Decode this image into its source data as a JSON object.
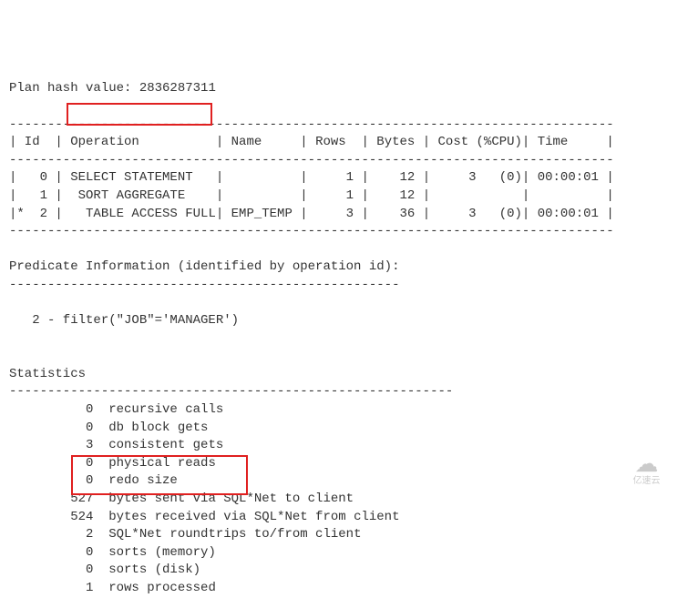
{
  "plan_hash_label": "Plan hash value: ",
  "plan_hash_value": "2836287311",
  "div_line": "-------------------------------------------------------------------------------",
  "header": {
    "id": "| Id  |",
    "operation": " Operation          |",
    "name": " Name     |",
    "rows": " Rows  |",
    "bytes": " Bytes |",
    "cost": " Cost (%CPU)|",
    "time": " Time     |"
  },
  "rows": [
    {
      "id": "|   0 |",
      "op": " SELECT STATEMENT   |",
      "name": "          |",
      "rows": "     1 |",
      "bytes": "    12 |",
      "cost": "     3   (0)|",
      "time": " 00:00:01 |"
    },
    {
      "id": "|   1 |",
      "op": "  SORT AGGREGATE    |",
      "name": "          |",
      "rows": "     1 |",
      "bytes": "    12 |",
      "cost": "            |",
      "time": "          |"
    },
    {
      "id": "|*  2 |",
      "op": "   TABLE ACCESS FULL|",
      "name": " EMP_TEMP |",
      "rows": "     3 |",
      "bytes": "    36 |",
      "cost": "     3   (0)|",
      "time": " 00:00:01 |"
    }
  ],
  "predicate_header": "Predicate Information (identified by operation id):",
  "predicate_line": "---------------------------------------------------",
  "predicate": "   2 - filter(\"JOB\"='MANAGER')",
  "stats_header": "Statistics",
  "stats_line": "----------------------------------------------------------",
  "stats": [
    {
      "val": "          0",
      "label": "  recursive calls"
    },
    {
      "val": "          0",
      "label": "  db block gets"
    },
    {
      "val": "          3",
      "label": "  consistent gets"
    },
    {
      "val": "          0",
      "label": "  physical reads"
    },
    {
      "val": "          0",
      "label": "  redo size"
    },
    {
      "val": "        527",
      "label": "  bytes sent via SQL*Net to client"
    },
    {
      "val": "        524",
      "label": "  bytes received via SQL*Net from client"
    },
    {
      "val": "          2",
      "label": "  SQL*Net roundtrips to/from client"
    },
    {
      "val": "          0",
      "label": "  sorts (memory)"
    },
    {
      "val": "          0",
      "label": "  sorts (disk)"
    },
    {
      "val": "          1",
      "label": "  rows processed"
    }
  ],
  "watermark_text": "亿速云"
}
